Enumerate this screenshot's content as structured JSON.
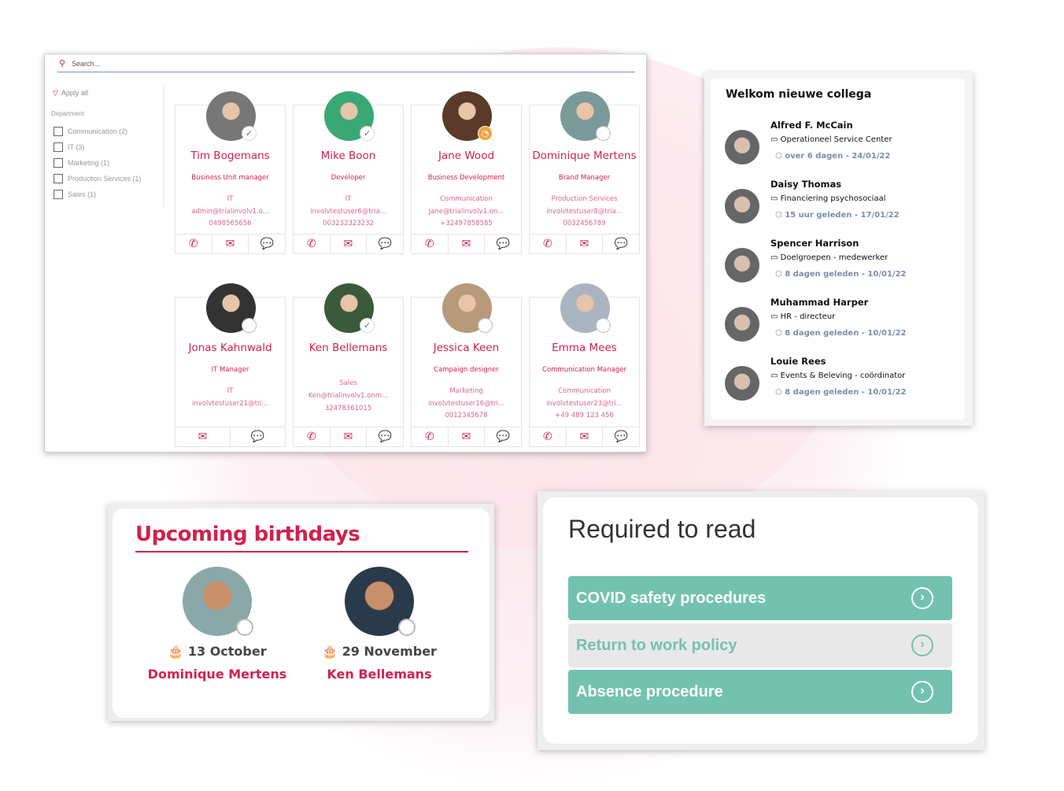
{
  "directory": {
    "search_placeholder": "Search...",
    "apply_all": "Apply all",
    "filter_label": "Department",
    "filters": [
      "Communication (2)",
      "IT (3)",
      "Marketing (1)",
      "Production Services (1)",
      "Sales (1)"
    ],
    "people": [
      {
        "name": "Tim Bogemans",
        "title": "Business Unit manager",
        "department": "IT",
        "email": "admin@trialinvolv1.o...",
        "phone": "0498565656",
        "status": "online",
        "actions": [
          "phone",
          "email",
          "chat"
        ],
        "avatar_color": "#777"
      },
      {
        "name": "Mike Boon",
        "title": "Developer",
        "department": "IT",
        "email": "involvtestuser6@tria...",
        "phone": "003232323232",
        "status": "online",
        "actions": [
          "phone",
          "email",
          "chat"
        ],
        "avatar_color": "#3aa874"
      },
      {
        "name": "Jane Wood",
        "title": "Business Development",
        "department": "Communication",
        "email": "Jane@trialinvolv1.on...",
        "phone": "+32497858585",
        "status": "away",
        "actions": [
          "phone",
          "email",
          "chat"
        ],
        "avatar_color": "#5a3a28"
      },
      {
        "name": "Dominique Mertens",
        "title": "Brand Manager",
        "department": "Production Services",
        "email": "involvtestuser8@tria...",
        "phone": "0032456789",
        "status": "offline",
        "actions": [
          "phone",
          "email",
          "chat"
        ],
        "avatar_color": "#7a9a9a"
      },
      {
        "name": "Jonas Kahnwald",
        "title": "IT Manager",
        "department": "IT",
        "email": "involvtestuser21@tri...",
        "phone": "",
        "status": "offline",
        "actions": [
          "email",
          "chat"
        ],
        "avatar_color": "#333"
      },
      {
        "name": "Ken Bellemans",
        "title": "",
        "department": "Sales",
        "email": "Ken@trialinvolv1.onm...",
        "phone": "32478361015",
        "status": "online",
        "actions": [
          "phone",
          "email",
          "chat"
        ],
        "avatar_color": "#3a5a3a"
      },
      {
        "name": "Jessica Keen",
        "title": "Campaign designer",
        "department": "Marketing",
        "email": "involvtestuser16@tri...",
        "phone": "0012345678",
        "status": "offline",
        "actions": [
          "phone",
          "email",
          "chat"
        ],
        "avatar_color": "#b89a7a"
      },
      {
        "name": "Emma Mees",
        "title": "Communication Manager",
        "department": "Communication",
        "email": "involvtestuser23@tri...",
        "phone": "+49 489 123 456",
        "status": "offline",
        "actions": [
          "phone",
          "email",
          "chat"
        ],
        "avatar_color": "#aab4c0"
      }
    ]
  },
  "welcome": {
    "title": "Welkom nieuwe collega",
    "people": [
      {
        "name": "Alfred F. McCain",
        "org": "Operationeel Service Center",
        "date": "over 6 dagen - 24/01/22"
      },
      {
        "name": "Daisy Thomas",
        "org": "Financiering psychosociaal",
        "date": "15 uur geleden - 17/01/22"
      },
      {
        "name": "Spencer Harrison",
        "org": "Doelgroepen - medewerker",
        "date": "8 dagen geleden - 10/01/22"
      },
      {
        "name": "Muhammad Harper",
        "org": "HR - directeur",
        "date": "8 dagen geleden - 10/01/22"
      },
      {
        "name": "Louie Rees",
        "org": "Events & Beleving - coördinator",
        "date": "8 dagen geleden - 10/01/22"
      }
    ]
  },
  "birthdays": {
    "title": "Upcoming birthdays",
    "people": [
      {
        "date": "13 October",
        "name": "Dominique Mertens"
      },
      {
        "date": "29 November",
        "name": "Ken Bellemans"
      }
    ]
  },
  "required": {
    "title": "Required to read",
    "items": [
      {
        "label": "COVID safety procedures",
        "state": "unread"
      },
      {
        "label": "Return to work policy",
        "state": "read"
      },
      {
        "label": "Absence procedure",
        "state": "unread"
      }
    ]
  },
  "colors": {
    "brand": "#d0224f",
    "teal": "#73c2af"
  }
}
